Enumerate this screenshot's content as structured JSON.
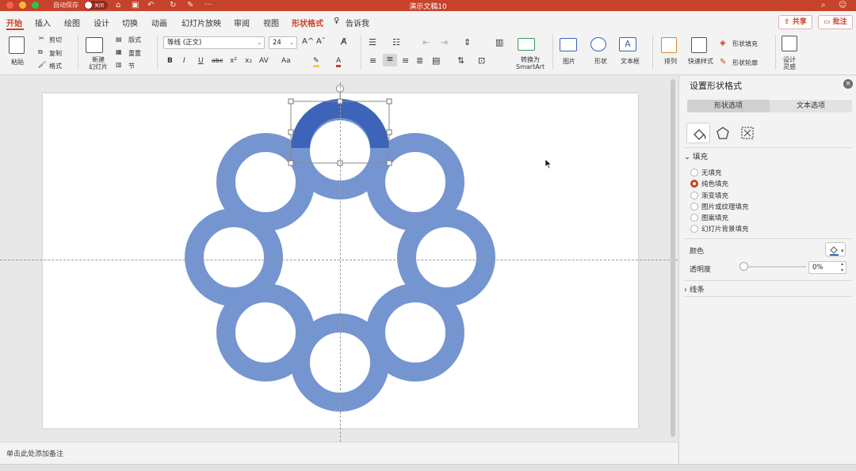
{
  "window": {
    "title": "演示文稿10",
    "autosave_label": "自动保存",
    "autosave_state": "关闭",
    "traffic_colors": [
      "#fe5f57",
      "#febc2e",
      "#28c840"
    ]
  },
  "tabs": [
    "开始",
    "插入",
    "绘图",
    "设计",
    "切换",
    "动画",
    "幻灯片放映",
    "审阅",
    "视图",
    "形状格式"
  ],
  "tell_me": "告诉我",
  "share_label": "共享",
  "comment_label": "批注",
  "ribbon": {
    "paste": "粘贴",
    "cut": "剪切",
    "copy": "复制",
    "format_painter": "格式",
    "new_slide": "新建\n幻灯片",
    "layout": "版式",
    "reset": "重置",
    "section": "节",
    "font_name": "等线 (正文)",
    "font_size": "24",
    "bold": "B",
    "italic": "I",
    "underline": "U",
    "strikethrough": "abc",
    "superscript": "x²",
    "subscript": "x₂",
    "char_spacing": "AV",
    "change_case": "Aa",
    "grow_font": "A^",
    "shrink_font": "Aˇ",
    "convert_smartart": "转换为\nSmartArt",
    "picture": "图片",
    "shape": "形状",
    "textbox": "文本框",
    "arrange": "排列",
    "quick_styles": "快速样式",
    "shape_fill": "形状填充",
    "shape_outline": "形状轮廓",
    "design_ideas": "设计\n灵感"
  },
  "notes_placeholder": "单击此处添加备注",
  "pane": {
    "title": "设置形状格式",
    "tabs": [
      "形状选项",
      "文本选项"
    ],
    "fill_section": "填充",
    "fill_options": [
      "无填充",
      "纯色填充",
      "渐变填充",
      "图片或纹理填充",
      "图案填充",
      "幻灯片背景填充"
    ],
    "selected_fill": "纯色填充",
    "color_label": "颜色",
    "transparency_label": "透明度",
    "transparency_value": "0%",
    "line_section": "线条"
  },
  "colors": {
    "accent": "#c7422b",
    "ring": "#7595d0",
    "ring_selected": "#3d64b8"
  }
}
